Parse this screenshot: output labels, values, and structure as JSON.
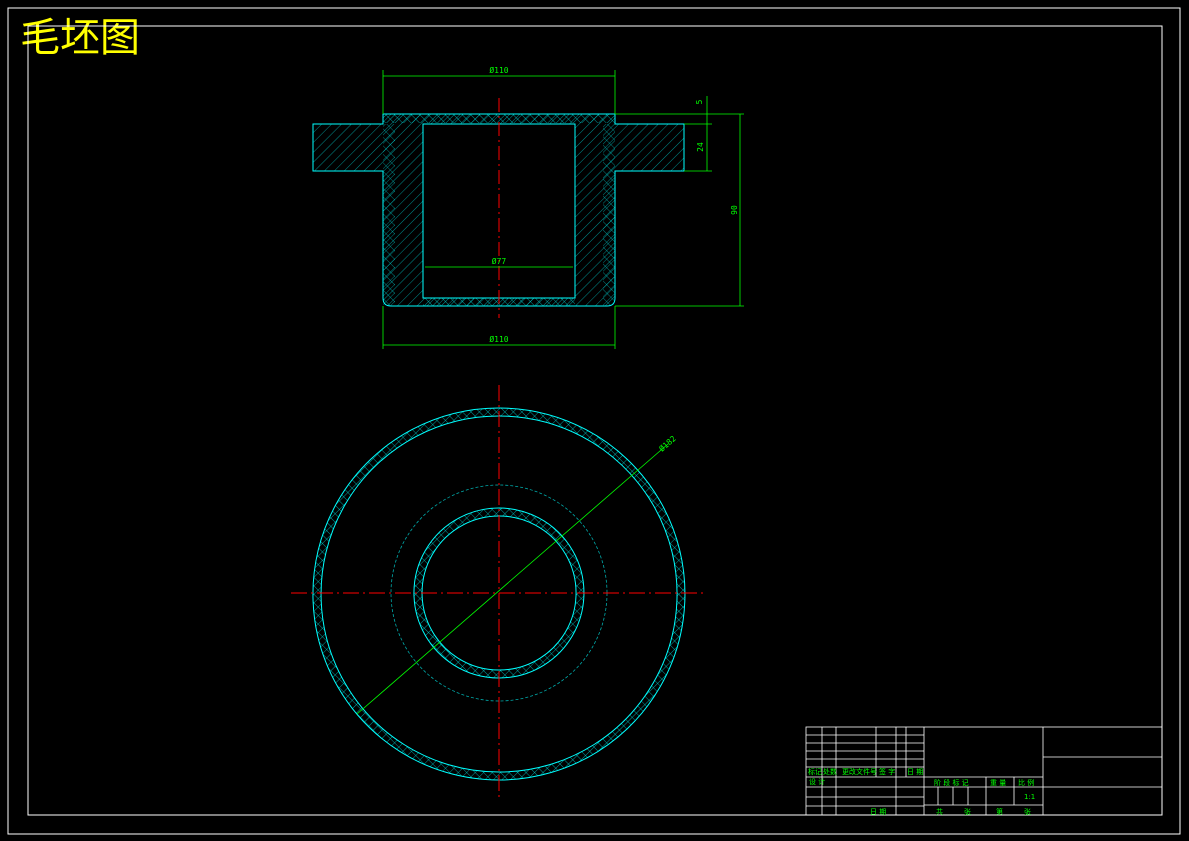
{
  "title": "毛坯图",
  "dimensions": {
    "top_width": "Ø110",
    "bottom_width": "Ø110",
    "bore": "Ø77",
    "height": "90",
    "flange": "24",
    "top_small": "5",
    "circle_dia": "Ø182"
  },
  "title_block": {
    "row_labels": [
      "标记",
      "处数",
      "更改文件号",
      "签 字",
      "日 期"
    ],
    "design": "设 计",
    "stage_labels": [
      "阶 段 标 记",
      "重 量",
      "比 例"
    ],
    "scale": "1:1",
    "approve": "日 期",
    "sheet": [
      "共",
      "张",
      "第",
      "张"
    ]
  },
  "colors": {
    "background": "#000000",
    "frame": "#ffffff",
    "part_outline": "#00ffff",
    "dimension": "#00ff00",
    "centerline": "#ff0000",
    "title": "#ffff00"
  }
}
